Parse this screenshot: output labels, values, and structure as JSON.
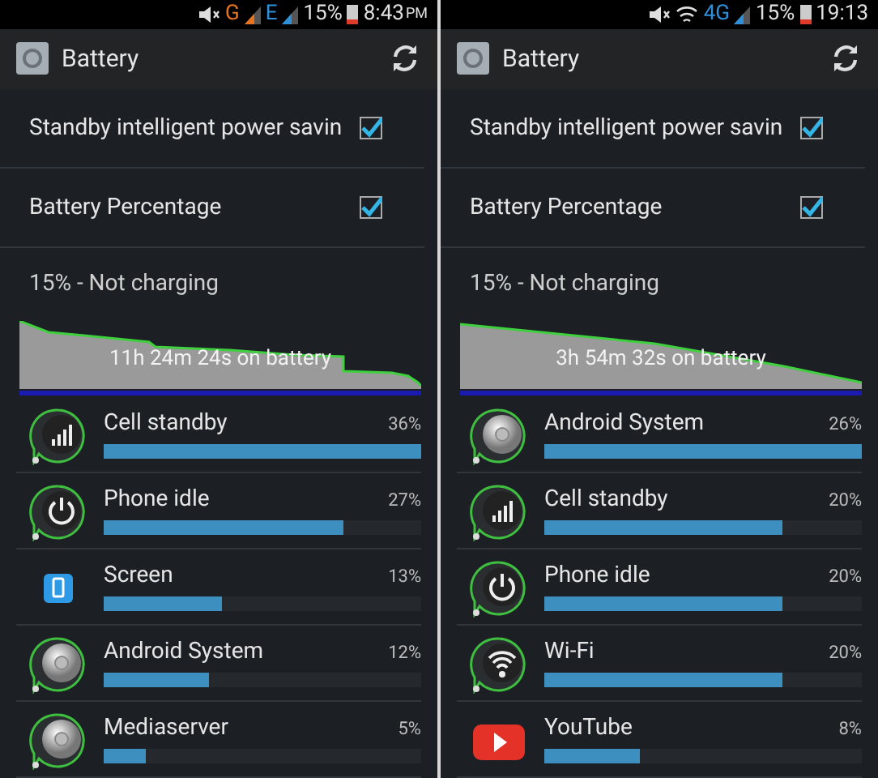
{
  "panels": [
    {
      "status_bar": {
        "networks": [
          {
            "label": "G",
            "color": "#e8731e"
          },
          {
            "label": "E",
            "color": "#2f8fd8"
          }
        ],
        "wifi": false,
        "battery": "15%",
        "time": "8:43",
        "ampm": "PM"
      },
      "action_bar": {
        "title": "Battery"
      },
      "settings": [
        {
          "label": "Standby intelligent power savin",
          "checked": true
        },
        {
          "label": "Battery Percentage",
          "checked": true
        }
      ],
      "charge_status": "15% - Not charging",
      "graph": {
        "kind": "stepped",
        "caption": "11h 24m 24s on battery"
      },
      "usage": [
        {
          "kind": "signal",
          "name": "Cell standby",
          "percent": "36%",
          "level": 1.0
        },
        {
          "kind": "power",
          "name": "Phone idle",
          "percent": "27%",
          "level": 0.755
        },
        {
          "kind": "screen",
          "name": "Screen",
          "percent": "13%",
          "level": 0.37
        },
        {
          "kind": "system",
          "name": "Android System",
          "percent": "12%",
          "level": 0.33
        },
        {
          "kind": "system",
          "name": "Mediaserver",
          "percent": "5%",
          "level": 0.135
        }
      ]
    },
    {
      "status_bar": {
        "networks": [
          {
            "label": "4G",
            "color": "#2f8fd8"
          }
        ],
        "wifi": true,
        "battery": "15%",
        "time": "19:13"
      },
      "action_bar": {
        "title": "Battery"
      },
      "settings": [
        {
          "label": "Standby intelligent power savin",
          "checked": true
        },
        {
          "label": "Battery Percentage",
          "checked": true
        }
      ],
      "charge_status": "15% - Not charging",
      "graph": {
        "kind": "linear",
        "caption": "3h 54m 32s on battery"
      },
      "usage": [
        {
          "kind": "system",
          "name": "Android System",
          "percent": "26%",
          "level": 1.0
        },
        {
          "kind": "signal",
          "name": "Cell standby",
          "percent": "20%",
          "level": 0.75
        },
        {
          "kind": "power",
          "name": "Phone idle",
          "percent": "20%",
          "level": 0.75
        },
        {
          "kind": "wifi",
          "name": "Wi-Fi",
          "percent": "20%",
          "level": 0.75
        },
        {
          "kind": "youtube",
          "name": "YouTube",
          "percent": "8%",
          "level": 0.3
        }
      ]
    }
  ]
}
